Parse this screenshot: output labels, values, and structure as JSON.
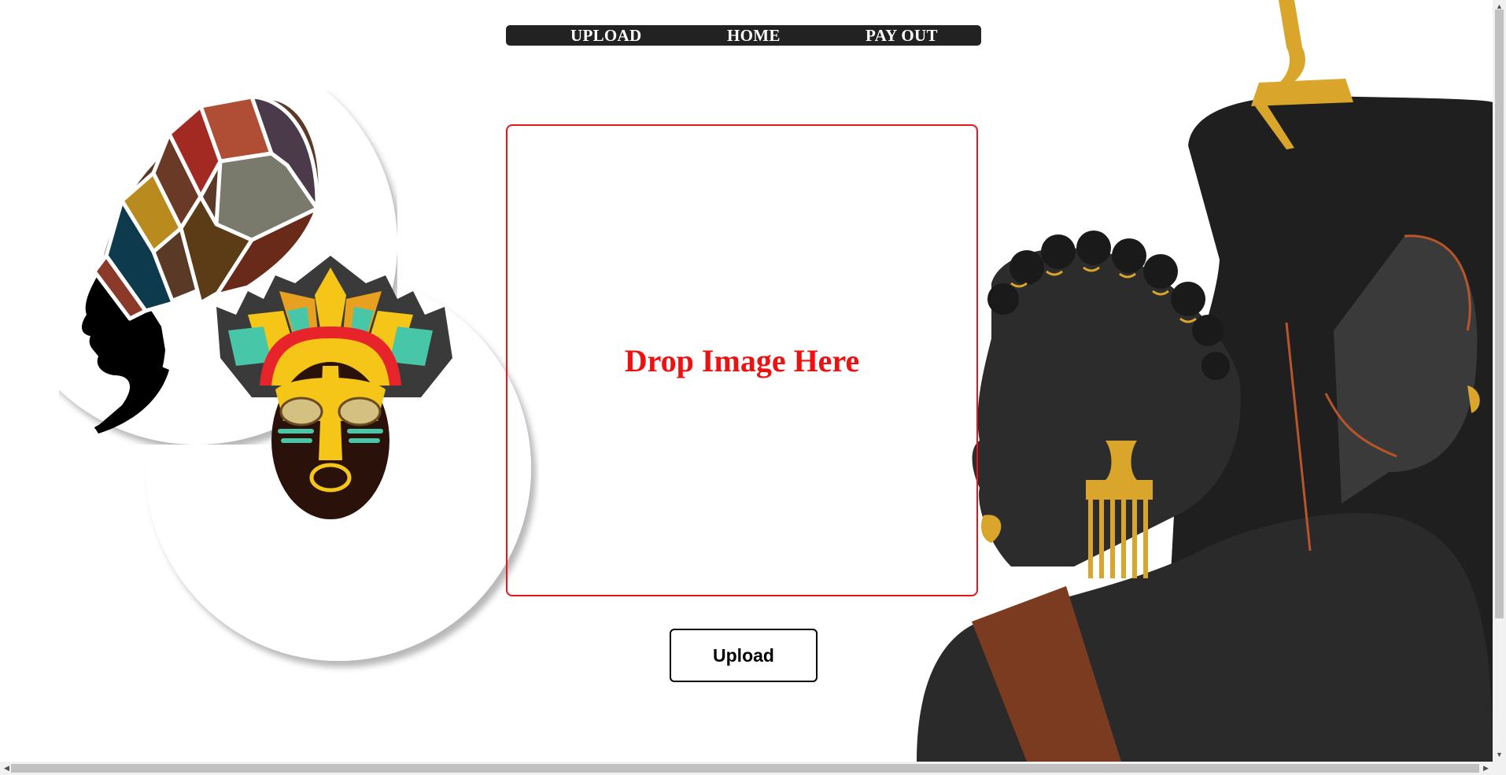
{
  "nav": {
    "items": [
      "UPLOAD",
      "HOME",
      "PAY OUT"
    ]
  },
  "dropzone": {
    "text": "Drop Image Here"
  },
  "upload_button": {
    "label": "Upload"
  },
  "colors": {
    "nav_bg": "#222222",
    "drop_border": "#e8141c",
    "drop_text": "#ee1111",
    "gold": "#d9a52b",
    "dark_skin": "#2b2b2b",
    "scarf": "#7b3b20"
  },
  "icons": {
    "left": "african-woman-headwrap-illustration",
    "mask": "tribal-mask-illustration",
    "right": "african-couple-portrait-illustration"
  }
}
